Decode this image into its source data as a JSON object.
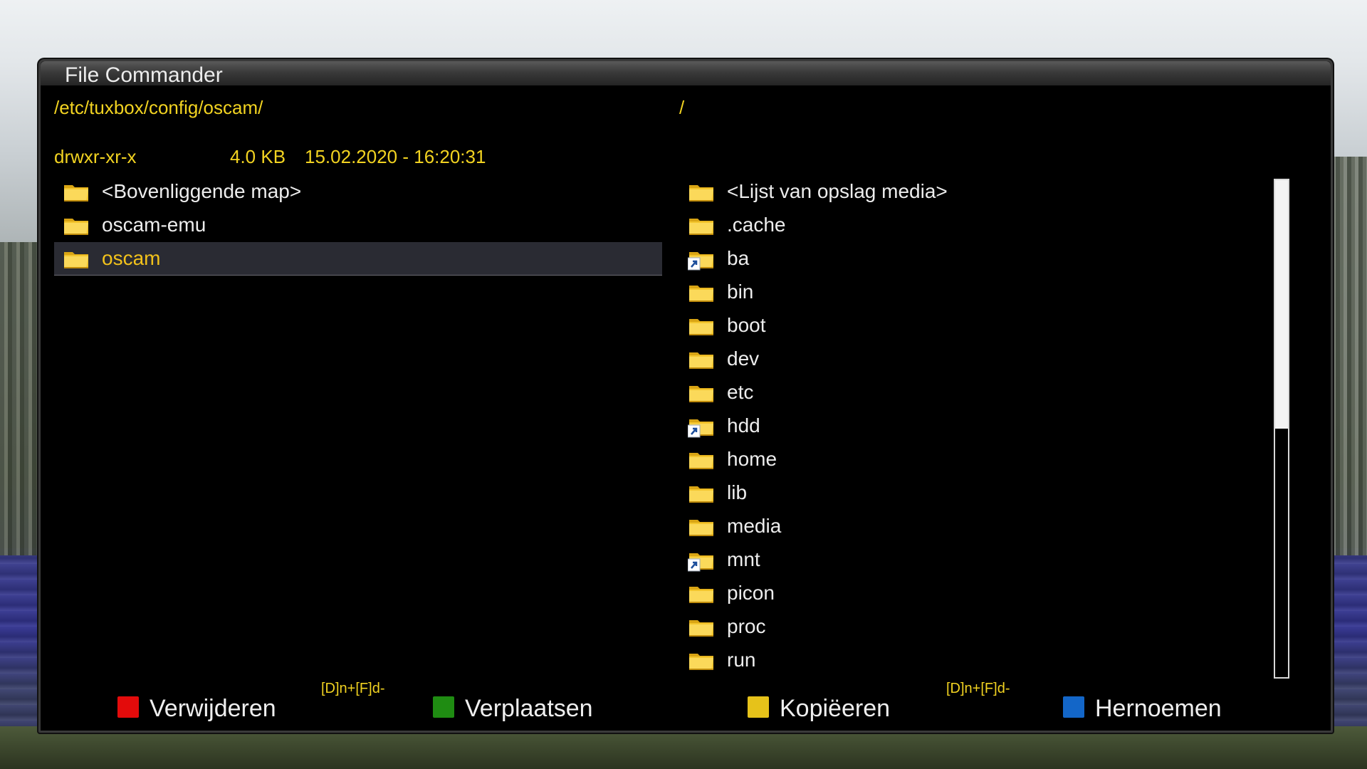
{
  "window": {
    "title": "File Commander"
  },
  "left_panel": {
    "path": "/etc/tuxbox/config/oscam/",
    "info": {
      "permissions": "drwxr-xr-x",
      "size": "4.0 KB",
      "datetime": "15.02.2020 - 16:20:31"
    },
    "items": [
      {
        "label": "<Bovenliggende map>",
        "icon": "folder-icon",
        "selected": false,
        "link": false
      },
      {
        "label": "oscam-emu",
        "icon": "folder-icon",
        "selected": false,
        "link": false
      },
      {
        "label": "oscam",
        "icon": "folder-icon",
        "selected": true,
        "link": false
      }
    ]
  },
  "right_panel": {
    "path": "/",
    "items": [
      {
        "label": "<Lijst van opslag media>",
        "icon": "folder-icon",
        "link": false
      },
      {
        "label": ".cache",
        "icon": "folder-icon",
        "link": false
      },
      {
        "label": "ba",
        "icon": "folder-link-icon",
        "link": true
      },
      {
        "label": "bin",
        "icon": "folder-icon",
        "link": false
      },
      {
        "label": "boot",
        "icon": "folder-icon",
        "link": false
      },
      {
        "label": "dev",
        "icon": "folder-icon",
        "link": false
      },
      {
        "label": "etc",
        "icon": "folder-icon",
        "link": false
      },
      {
        "label": "hdd",
        "icon": "folder-link-icon",
        "link": true
      },
      {
        "label": "home",
        "icon": "folder-icon",
        "link": false
      },
      {
        "label": "lib",
        "icon": "folder-icon",
        "link": false
      },
      {
        "label": "media",
        "icon": "folder-icon",
        "link": false
      },
      {
        "label": "mnt",
        "icon": "folder-link-icon",
        "link": true
      },
      {
        "label": "picon",
        "icon": "folder-icon",
        "link": false
      },
      {
        "label": "proc",
        "icon": "folder-icon",
        "link": false
      },
      {
        "label": "run",
        "icon": "folder-icon",
        "link": false
      }
    ],
    "scroll_fraction_visible": 0.5
  },
  "footer": {
    "hint_left": "[D]n+[F]d-",
    "hint_right": "[D]n+[F]d-",
    "buttons": [
      {
        "label": "Verwijderen",
        "color": "#e30b0b",
        "key": "red"
      },
      {
        "label": "Verplaatsen",
        "color": "#1f8c12",
        "key": "green"
      },
      {
        "label": "Kopiëeren",
        "color": "#e6c21a",
        "key": "yellow"
      },
      {
        "label": "Hernoemen",
        "color": "#1366c8",
        "key": "blue"
      }
    ]
  },
  "colors": {
    "accent_yellow": "#f2d321",
    "selected_text": "#f2c21b",
    "selected_bg": "#2a2b33"
  }
}
